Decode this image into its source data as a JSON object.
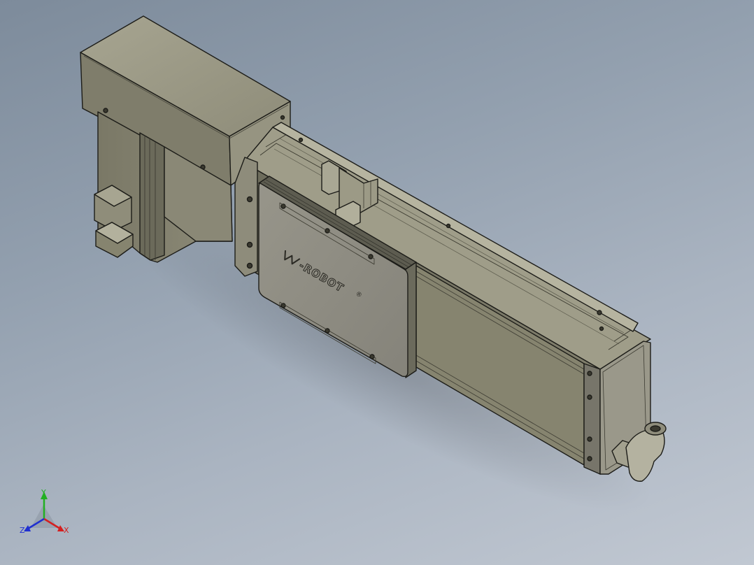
{
  "viewport": {
    "background_top": "#7d8b9b",
    "background_bottom": "#c1c8d2"
  },
  "model": {
    "body_color": "#8c8a78",
    "body_light": "#a9a794",
    "body_dark": "#5f5e51",
    "edge_color": "#1c1c18",
    "logo": {
      "text": "-ROBOT",
      "mark": "®"
    }
  },
  "triad": {
    "x_label": "X",
    "y_label": "Y",
    "z_label": "Z",
    "x_color": "#d42020",
    "y_color": "#22b022",
    "z_color": "#2030d0"
  }
}
